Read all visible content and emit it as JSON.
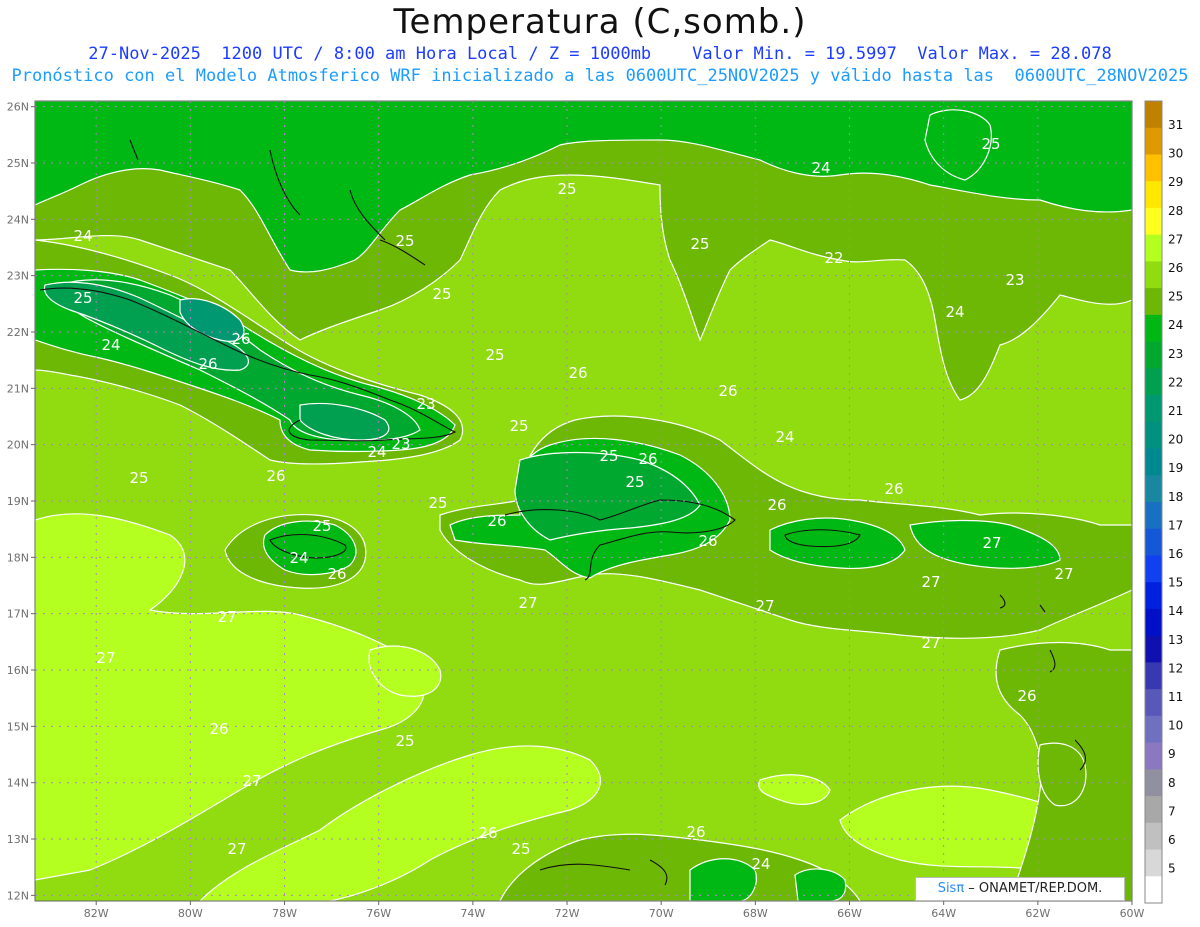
{
  "header": {
    "title": "Temperatura (C,somb.)",
    "line1": "27-Nov-2025  1200 UTC / 8:00 am Hora Local / Z = 1000mb    Valor Min. = 19.5997  Valor Max. = 28.078",
    "line2": "Pronóstico con el Modelo Atmosferico WRF inicializado a las 0600UTC_25NOV2025 y válido hasta las  0600UTC_28NOV2025"
  },
  "map": {
    "lon_range": [
      -83.3,
      -60.0
    ],
    "lat_range": [
      11.9,
      26.1
    ],
    "lon_ticks": [
      "82W",
      "80W",
      "78W",
      "76W",
      "74W",
      "72W",
      "70W",
      "68W",
      "66W",
      "64W",
      "62W",
      "60W"
    ],
    "lat_ticks": [
      "12N",
      "13N",
      "14N",
      "15N",
      "16N",
      "17N",
      "18N",
      "19N",
      "20N",
      "21N",
      "22N",
      "23N",
      "24N",
      "25N",
      "26N"
    ],
    "contour_labels": [
      "24",
      "24",
      "25",
      "25",
      "25",
      "25",
      "25",
      "22",
      "23",
      "24",
      "25",
      "26",
      "26",
      "24",
      "25",
      "26",
      "26",
      "23",
      "24",
      "23",
      "25",
      "24",
      "25",
      "26",
      "25",
      "26",
      "25",
      "25",
      "26",
      "26",
      "26",
      "25",
      "24",
      "26",
      "26",
      "27",
      "27",
      "27",
      "27",
      "27",
      "27",
      "26",
      "27",
      "27",
      "26",
      "25",
      "27",
      "26",
      "25",
      "26",
      "24",
      "27"
    ]
  },
  "colorbar": {
    "labels": [
      "31",
      "30",
      "29",
      "28",
      "27",
      "26",
      "25",
      "24",
      "23",
      "22",
      "21",
      "20",
      "19",
      "18",
      "17",
      "16",
      "15",
      "14",
      "13",
      "12",
      "11",
      "10",
      "9",
      "8",
      "7",
      "6",
      "5"
    ],
    "colors": [
      "#c08000",
      "#e09800",
      "#ffc000",
      "#ffe800",
      "#ffff20",
      "#b4ff20",
      "#90dc10",
      "#6cb804",
      "#00b814",
      "#00a830",
      "#00a050",
      "#009870",
      "#009080",
      "#008890",
      "#1888a0",
      "#1870c0",
      "#1458d8",
      "#1040f0",
      "#0020e0",
      "#0010c8",
      "#1010b0",
      "#3838b0",
      "#5858b8",
      "#7070c0",
      "#8c78c0",
      "#9090a0",
      "#a8a8a8",
      "#c0c0c0",
      "#d8d8d8",
      "#ffffff"
    ]
  },
  "credit": {
    "sis": "Sisπ",
    "rest": " – ONAMET/REP.DOM."
  }
}
